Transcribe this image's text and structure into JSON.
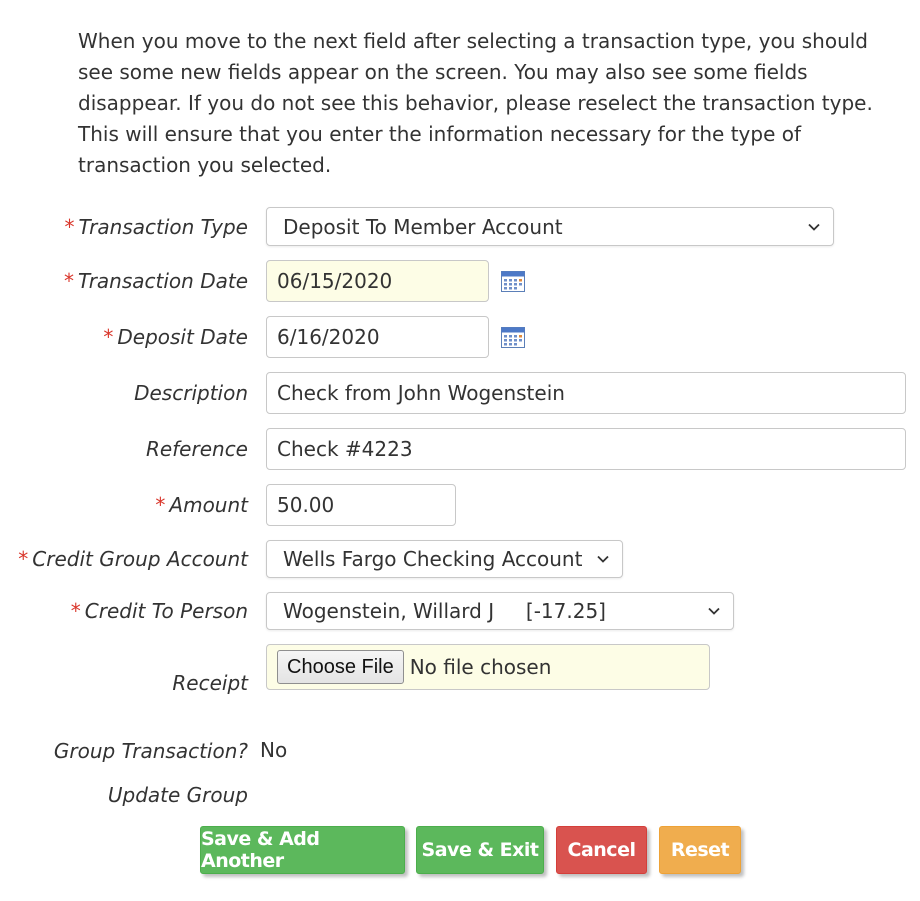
{
  "intro_text": "When you move to the next field after selecting a transaction type, you should see some new fields appear on the screen. You may also see some fields disappear. If you do not see this behavior, please reselect the transaction type. This will ensure that you enter the information necessary for the type of transaction you selected.",
  "required_marker": "*",
  "colors": {
    "required": "#d9362b",
    "green_button": "#5cb85c",
    "red_button": "#d9534f",
    "orange_button": "#f0ad4e",
    "date_field_bg": "#fdfde6"
  },
  "form": {
    "transaction_type": {
      "label": "Transaction Type",
      "value": "Deposit To Member Account"
    },
    "transaction_date": {
      "label": "Transaction Date",
      "value": "06/15/2020",
      "icon": "calendar-icon"
    },
    "deposit_date": {
      "label": "Deposit Date",
      "value": "6/16/2020",
      "icon": "calendar-icon"
    },
    "description": {
      "label": "Description",
      "value": "Check from John Wogenstein"
    },
    "reference": {
      "label": "Reference",
      "value": "Check #4223"
    },
    "amount": {
      "label": "Amount",
      "value": "50.00"
    },
    "credit_group_account": {
      "label": "Credit Group Account",
      "value": "Wells Fargo Checking Account"
    },
    "credit_to_person": {
      "label": "Credit To Person",
      "value": "Wogenstein, Willard J     [-17.25]"
    },
    "receipt": {
      "label": "Receipt",
      "button_label": "Choose File",
      "status": "No file chosen"
    },
    "group_transaction": {
      "label": "Group Transaction?",
      "value": "No"
    },
    "update_group": {
      "label": "Update Group"
    }
  },
  "buttons": {
    "save_add_another": "Save & Add Another",
    "save_exit": "Save & Exit",
    "cancel": "Cancel",
    "reset": "Reset"
  }
}
